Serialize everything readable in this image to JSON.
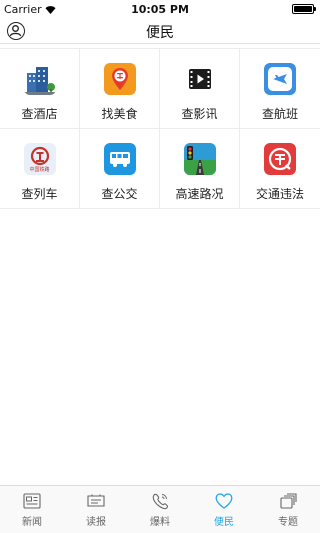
{
  "status_bar": {
    "carrier": "Carrier",
    "time": "10:05 PM"
  },
  "header": {
    "title": "便民"
  },
  "services": [
    {
      "label": "查酒店",
      "icon": "hotel-icon"
    },
    {
      "label": "找美食",
      "icon": "food-icon"
    },
    {
      "label": "查影讯",
      "icon": "movie-icon"
    },
    {
      "label": "查航班",
      "icon": "flight-icon"
    },
    {
      "label": "查列车",
      "icon": "train-icon"
    },
    {
      "label": "查公交",
      "icon": "bus-icon"
    },
    {
      "label": "高速路况",
      "icon": "highway-traffic-icon"
    },
    {
      "label": "交通违法",
      "icon": "traffic-violation-icon"
    }
  ],
  "train_logo_text": "中国铁路",
  "tabs": [
    {
      "label": "新闻",
      "icon": "news-icon",
      "active": false
    },
    {
      "label": "读报",
      "icon": "newspaper-icon",
      "active": false
    },
    {
      "label": "爆料",
      "icon": "tip-phone-icon",
      "active": false
    },
    {
      "label": "便民",
      "icon": "heart-icon",
      "active": true
    },
    {
      "label": "专题",
      "icon": "topics-icon",
      "active": false
    }
  ],
  "colors": {
    "accent": "#22a9e4",
    "tab_inactive": "#666666"
  }
}
